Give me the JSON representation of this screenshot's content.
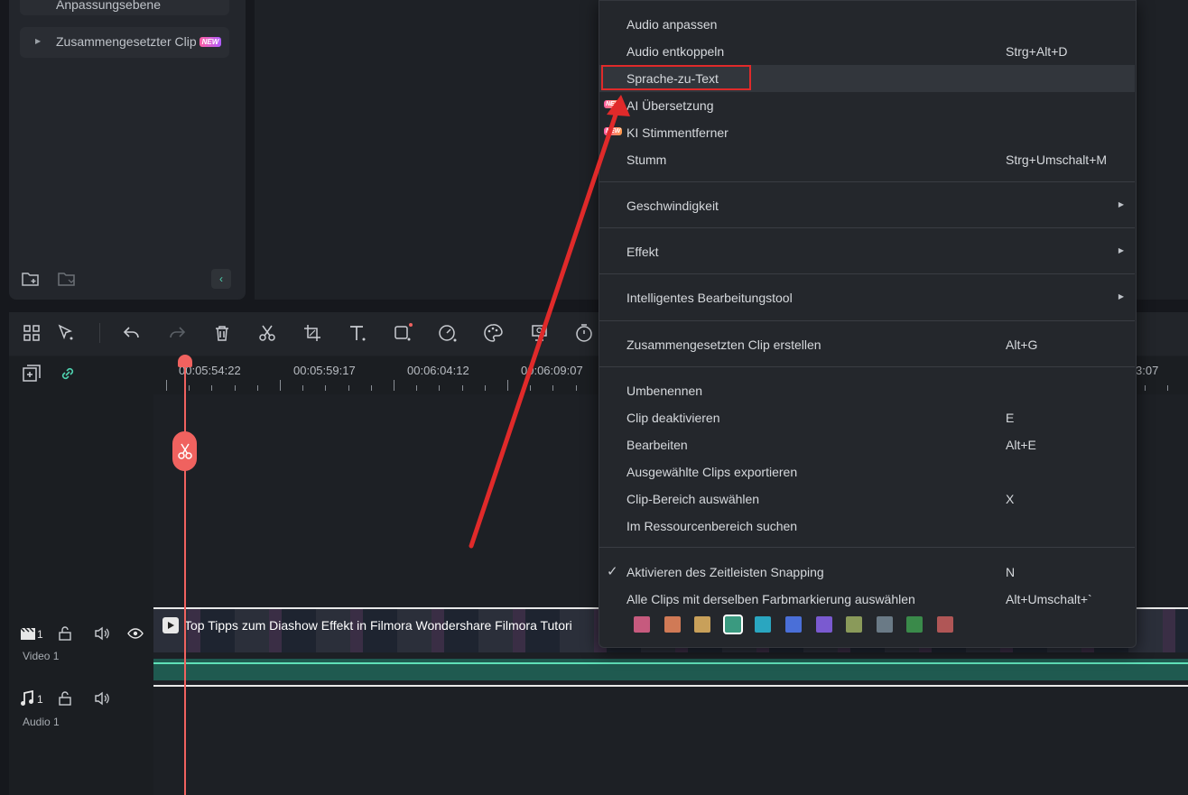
{
  "sidebar": {
    "items": [
      {
        "label": "Anpassungsebene"
      },
      {
        "label": "Zusammengesetzter Clip",
        "badge": "NEW"
      }
    ]
  },
  "timeline": {
    "timecodes": [
      "00:05:54:22",
      "00:05:59:17",
      "00:06:04:12",
      "00:06:09:07",
      "3:07"
    ],
    "clip_title": "Top Tipps zum Diashow Effekt in Filmora  Wondershare Filmora Tutori",
    "tracks": {
      "video": {
        "index": "1",
        "label": "Video 1"
      },
      "audio": {
        "index": "1",
        "label": "Audio 1"
      }
    }
  },
  "context_menu": {
    "items": [
      {
        "label": "Audio anpassen",
        "shortcut": ""
      },
      {
        "label": "Audio entkoppeln",
        "shortcut": "Strg+Alt+D"
      },
      {
        "label": "Sprache-zu-Text",
        "shortcut": ""
      },
      {
        "label": "AI Übersetzung",
        "shortcut": "",
        "badge": "NEW"
      },
      {
        "label": "KI Stimmentferner",
        "shortcut": "",
        "badge": "NEW"
      },
      {
        "label": "Stumm",
        "shortcut": "Strg+Umschalt+M"
      },
      {
        "label": "Geschwindigkeit",
        "shortcut": ""
      },
      {
        "label": "Effekt",
        "shortcut": ""
      },
      {
        "label": "Intelligentes Bearbeitungstool",
        "shortcut": ""
      },
      {
        "label": "Zusammengesetzten Clip erstellen",
        "shortcut": "Alt+G"
      },
      {
        "label": "Umbenennen",
        "shortcut": ""
      },
      {
        "label": "Clip deaktivieren",
        "shortcut": "E"
      },
      {
        "label": "Bearbeiten",
        "shortcut": "Alt+E"
      },
      {
        "label": "Ausgewählte Clips exportieren",
        "shortcut": ""
      },
      {
        "label": "Clip-Bereich auswählen",
        "shortcut": "X"
      },
      {
        "label": "Im Ressourcenbereich suchen",
        "shortcut": ""
      },
      {
        "label": "Aktivieren des Zeitleisten Snapping",
        "shortcut": "N",
        "checked": true
      },
      {
        "label": "Alle Clips mit derselben Farbmarkierung auswählen",
        "shortcut": "Alt+Umschalt+`"
      }
    ],
    "color_marks": [
      "#c65a7e",
      "#d07a56",
      "#c8a05a",
      "#3a9a80",
      "#2aa6c0",
      "#4a6fd8",
      "#7a5ad0",
      "#8a9a5a",
      "#6a7a86",
      "#3a8a4a",
      "#b05656"
    ],
    "selected_color": "#3a9a80"
  },
  "colors": {
    "playhead": "#f0625f",
    "annotation": "#e02a2a"
  }
}
